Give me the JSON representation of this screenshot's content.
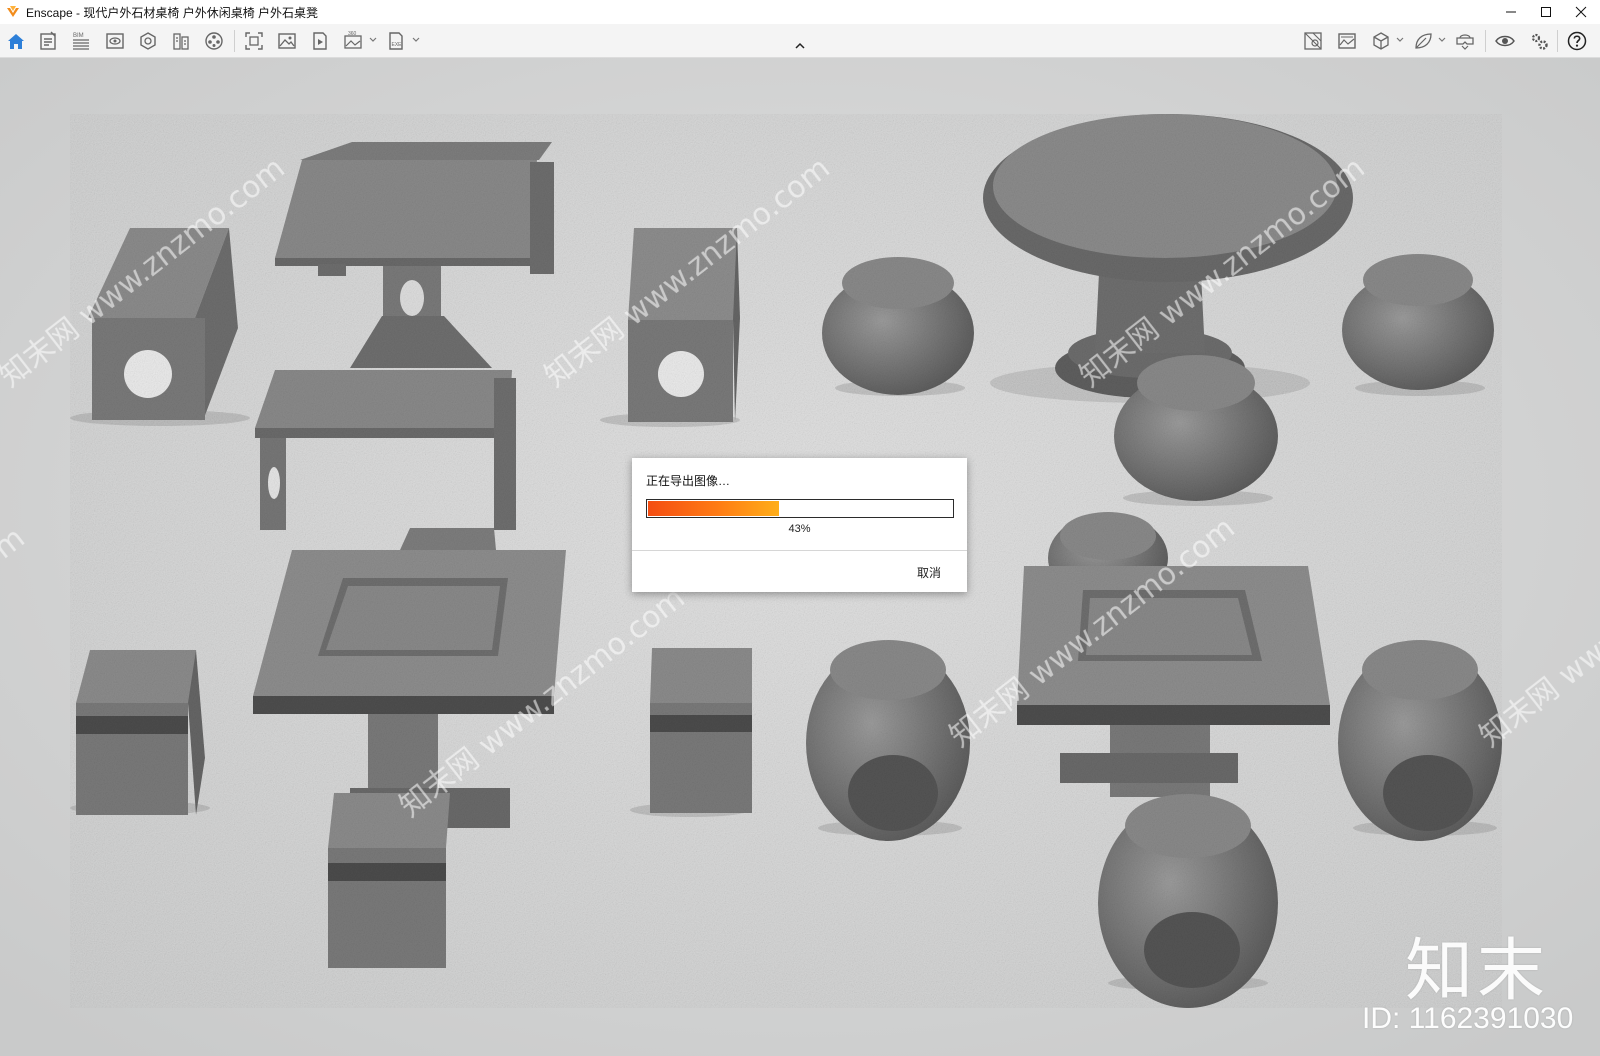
{
  "window": {
    "title": "Enscape - 现代户外石材桌椅 户外休闲桌椅 户外石桌凳",
    "controls": [
      "minimize-icon",
      "maximize-icon",
      "close-icon"
    ]
  },
  "toolbar": {
    "left_icons": [
      "home-icon",
      "project-icon",
      "bim-icon",
      "view-icon",
      "material-icon",
      "asset-library-icon",
      "video-editor-icon",
      "screenshot-icon",
      "render-image-icon",
      "render-video-icon",
      "panorama-360-icon",
      "export-exe-icon"
    ],
    "right_icons": [
      "site-context-icon",
      "atmosphere-icon",
      "cube-view-icon",
      "leaf-icon",
      "vr-headset-icon",
      "visibility-icon",
      "settings-icon",
      "help-icon"
    ],
    "bim_label": "BIM",
    "panorama_label": "360",
    "exe_label": "EXE"
  },
  "dialog": {
    "message": "正在导出图像…",
    "progress_percent": 43,
    "progress_text": "43%",
    "cancel_label": "取消",
    "progress_colors": {
      "start": "#f44d12",
      "end": "#ffae18"
    }
  },
  "watermark": {
    "logo_text": "知末",
    "id_text": "ID: 1162391030",
    "diagonal_text": "知末网 www.znzmo.com"
  },
  "colors": {
    "accent_home": "#2d7fd8",
    "stone_top": "#8b8b8b",
    "stone_side": "#6f6f6f",
    "floor": "#cfd0d0"
  }
}
